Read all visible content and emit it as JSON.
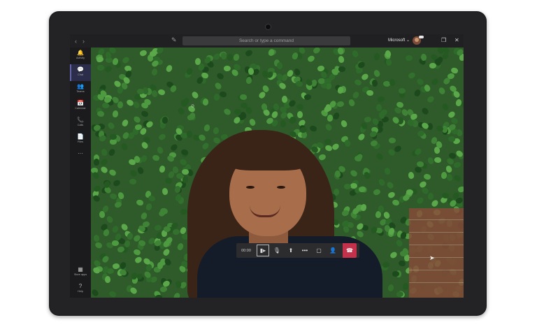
{
  "titlebar": {
    "back": "‹",
    "forward": "›",
    "search_placeholder": "Search or type a command",
    "org": "Microsoft ⌄",
    "window_restore": "❐",
    "window_close": "✕"
  },
  "rail": {
    "items": [
      {
        "label": "Activity",
        "icon": "🔔"
      },
      {
        "label": "Chat",
        "icon": "💬"
      },
      {
        "label": "Teams",
        "icon": "👥"
      },
      {
        "label": "Calendar",
        "icon": "📅"
      },
      {
        "label": "Calls",
        "icon": "📞"
      },
      {
        "label": "Files",
        "icon": "📄"
      },
      {
        "label": "",
        "icon": "···"
      }
    ],
    "bottom": [
      {
        "label": "Store apps",
        "icon": "▦"
      },
      {
        "label": "Help",
        "icon": "?"
      }
    ]
  },
  "call": {
    "timer": "00:00",
    "camera": "▮▸",
    "mic": "🎙",
    "share": "⬆",
    "more": "•••",
    "chat": "▢",
    "people": "👤",
    "hangup": "☎"
  },
  "colors": {
    "accent": "#6264a7",
    "hangup": "#c4314b",
    "titlebar": "#202022",
    "rail": "#1b1b1d"
  }
}
